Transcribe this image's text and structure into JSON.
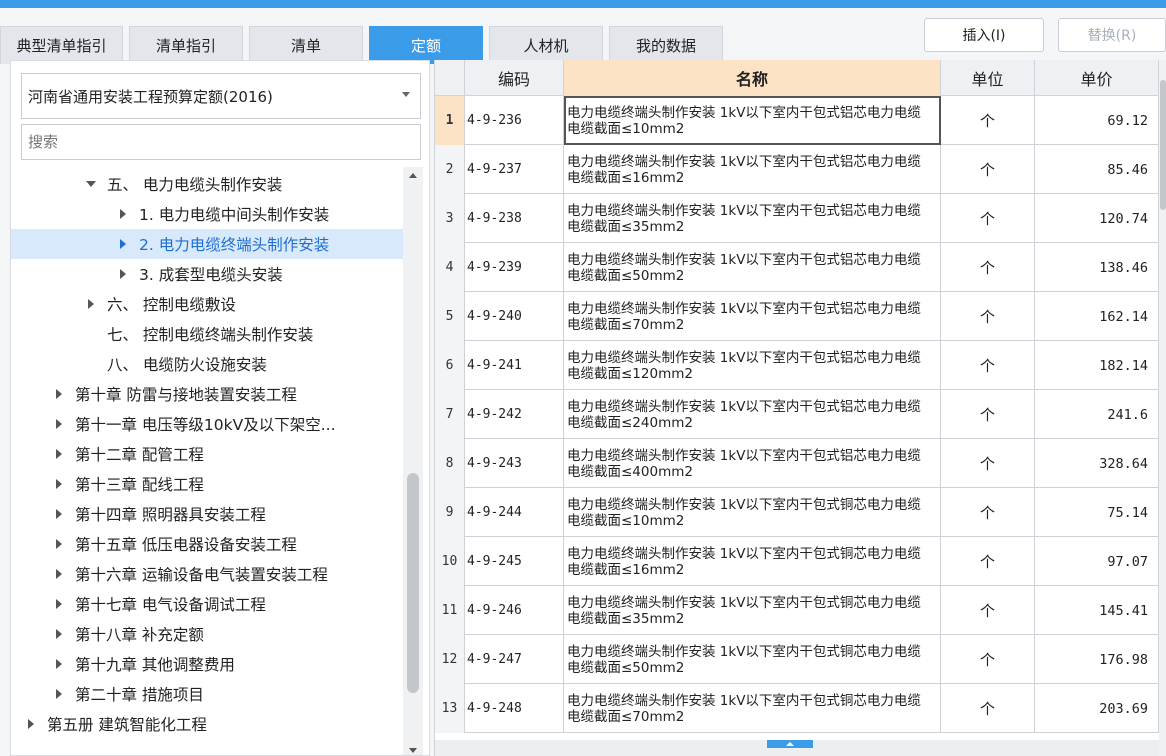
{
  "tabs": [
    "典型清单指引",
    "清单指引",
    "清单",
    "定额",
    "人材机",
    "我的数据"
  ],
  "active_tab": "定额",
  "toolbar": {
    "insert_label": "插入(I)",
    "replace_label": "替换(R)"
  },
  "left": {
    "quota_library": "河南省通用安装工程预算定额(2016)",
    "search_placeholder": "搜索",
    "tree": [
      {
        "label": "五、 电力电缆头制作安装",
        "expander": "expanded"
      },
      {
        "label": "1. 电力电缆中间头制作安装",
        "expander": "collapsed"
      },
      {
        "label": "2. 电力电缆终端头制作安装",
        "expander": "collapsed",
        "selected": true
      },
      {
        "label": "3. 成套型电缆头安装",
        "expander": "collapsed"
      },
      {
        "label": "六、 控制电缆敷设",
        "expander": "collapsed"
      },
      {
        "label": "七、 控制电缆终端头制作安装",
        "expander": "none"
      },
      {
        "label": "八、 电缆防火设施安装",
        "expander": "none"
      },
      {
        "label": "第十章 防雷与接地装置安装工程",
        "expander": "collapsed"
      },
      {
        "label": "第十一章 电压等级10kV及以下架空...",
        "expander": "collapsed"
      },
      {
        "label": "第十二章 配管工程",
        "expander": "collapsed"
      },
      {
        "label": "第十三章 配线工程",
        "expander": "collapsed"
      },
      {
        "label": "第十四章 照明器具安装工程",
        "expander": "collapsed"
      },
      {
        "label": "第十五章 低压电器设备安装工程",
        "expander": "collapsed"
      },
      {
        "label": "第十六章 运输设备电气装置安装工程",
        "expander": "collapsed"
      },
      {
        "label": "第十七章 电气设备调试工程",
        "expander": "collapsed"
      },
      {
        "label": "第十八章 补充定额",
        "expander": "collapsed"
      },
      {
        "label": "第十九章 其他调整费用",
        "expander": "collapsed"
      },
      {
        "label": "第二十章 措施项目",
        "expander": "collapsed"
      },
      {
        "label": "第五册 建筑智能化工程",
        "expander": "collapsed"
      }
    ]
  },
  "grid": {
    "headers": {
      "code": "编码",
      "name": "名称",
      "unit": "单位",
      "price": "单价"
    },
    "rows": [
      {
        "no": "1",
        "code": "4-9-236",
        "name": "电力电缆终端头制作安装 1kV以下室内干包式铝芯电力电缆 电缆截面≤10mm2",
        "unit": "个",
        "price": "69.12"
      },
      {
        "no": "2",
        "code": "4-9-237",
        "name": "电力电缆终端头制作安装 1kV以下室内干包式铝芯电力电缆 电缆截面≤16mm2",
        "unit": "个",
        "price": "85.46"
      },
      {
        "no": "3",
        "code": "4-9-238",
        "name": "电力电缆终端头制作安装 1kV以下室内干包式铝芯电力电缆 电缆截面≤35mm2",
        "unit": "个",
        "price": "120.74"
      },
      {
        "no": "4",
        "code": "4-9-239",
        "name": "电力电缆终端头制作安装 1kV以下室内干包式铝芯电力电缆 电缆截面≤50mm2",
        "unit": "个",
        "price": "138.46"
      },
      {
        "no": "5",
        "code": "4-9-240",
        "name": "电力电缆终端头制作安装 1kV以下室内干包式铝芯电力电缆 电缆截面≤70mm2",
        "unit": "个",
        "price": "162.14"
      },
      {
        "no": "6",
        "code": "4-9-241",
        "name": "电力电缆终端头制作安装 1kV以下室内干包式铝芯电力电缆 电缆截面≤120mm2",
        "unit": "个",
        "price": "182.14"
      },
      {
        "no": "7",
        "code": "4-9-242",
        "name": "电力电缆终端头制作安装 1kV以下室内干包式铝芯电力电缆 电缆截面≤240mm2",
        "unit": "个",
        "price": "241.6"
      },
      {
        "no": "8",
        "code": "4-9-243",
        "name": "电力电缆终端头制作安装 1kV以下室内干包式铝芯电力电缆 电缆截面≤400mm2",
        "unit": "个",
        "price": "328.64"
      },
      {
        "no": "9",
        "code": "4-9-244",
        "name": "电力电缆终端头制作安装 1kV以下室内干包式铜芯电力电缆 电缆截面≤10mm2",
        "unit": "个",
        "price": "75.14"
      },
      {
        "no": "10",
        "code": "4-9-245",
        "name": "电力电缆终端头制作安装 1kV以下室内干包式铜芯电力电缆 电缆截面≤16mm2",
        "unit": "个",
        "price": "97.07"
      },
      {
        "no": "11",
        "code": "4-9-246",
        "name": "电力电缆终端头制作安装 1kV以下室内干包式铜芯电力电缆 电缆截面≤35mm2",
        "unit": "个",
        "price": "145.41"
      },
      {
        "no": "12",
        "code": "4-9-247",
        "name": "电力电缆终端头制作安装 1kV以下室内干包式铜芯电力电缆 电缆截面≤50mm2",
        "unit": "个",
        "price": "176.98"
      },
      {
        "no": "13",
        "code": "4-9-248",
        "name": "电力电缆终端头制作安装 1kV以下室内干包式铜芯电力电缆 电缆截面≤70mm2",
        "unit": "个",
        "price": "203.69"
      }
    ]
  },
  "colors": {
    "accent": "#3a9be8",
    "name_header": "#fde3c5",
    "selection": "#d8e9fb"
  }
}
